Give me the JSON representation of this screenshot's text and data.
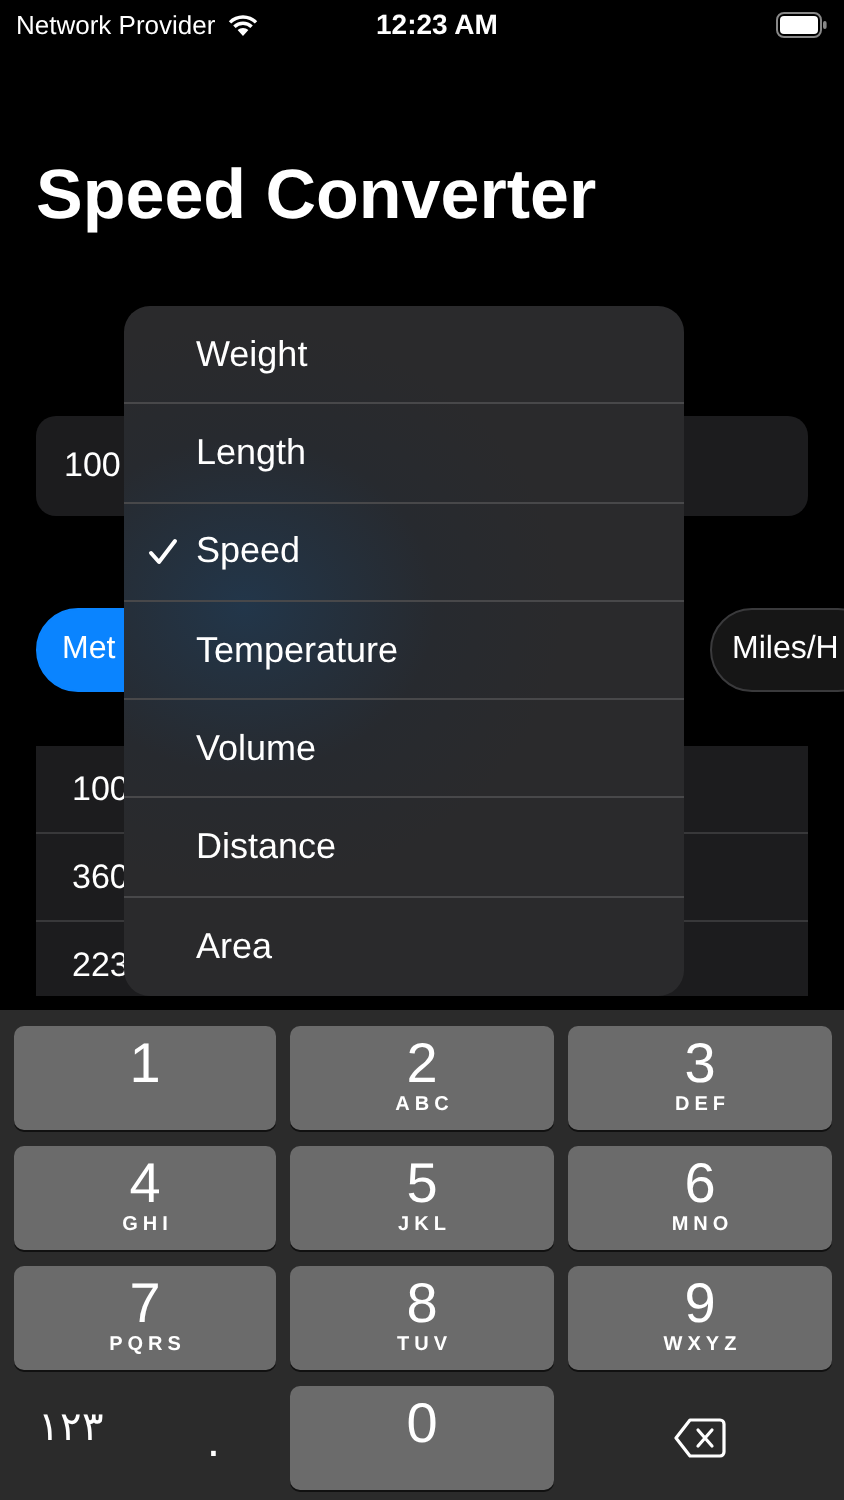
{
  "status_bar": {
    "carrier": "Network Provider",
    "time": "12:23 AM"
  },
  "title": "Speed Converter",
  "input": {
    "value": "100"
  },
  "units": [
    {
      "label": "Met",
      "selected": true
    },
    {
      "label": "Miles/H",
      "selected": false
    }
  ],
  "results": [
    {
      "text": "100"
    },
    {
      "text": "360"
    },
    {
      "text": "223"
    }
  ],
  "menu": [
    {
      "label": "Weight",
      "selected": false
    },
    {
      "label": "Length",
      "selected": false
    },
    {
      "label": "Speed",
      "selected": true
    },
    {
      "label": "Temperature",
      "selected": false
    },
    {
      "label": "Volume",
      "selected": false
    },
    {
      "label": "Distance",
      "selected": false
    },
    {
      "label": "Area",
      "selected": false
    }
  ],
  "keypad": [
    {
      "kind": "digit",
      "digit": "1"
    },
    {
      "kind": "digit",
      "digit": "2",
      "letters": "ABC"
    },
    {
      "kind": "digit",
      "digit": "3",
      "letters": "DEF"
    },
    {
      "kind": "digit",
      "digit": "4",
      "letters": "GHI"
    },
    {
      "kind": "digit",
      "digit": "5",
      "letters": "JKL"
    },
    {
      "kind": "digit",
      "digit": "6",
      "letters": "MNO"
    },
    {
      "kind": "digit",
      "digit": "7",
      "letters": "PQRS"
    },
    {
      "kind": "digit",
      "digit": "8",
      "letters": "TUV"
    },
    {
      "kind": "digit",
      "digit": "9",
      "letters": "WXYZ"
    },
    {
      "kind": "mode",
      "label": "۱۲۳"
    },
    {
      "kind": "decimal",
      "label": "."
    },
    {
      "kind": "digit",
      "digit": "0"
    },
    {
      "kind": "delete"
    }
  ]
}
